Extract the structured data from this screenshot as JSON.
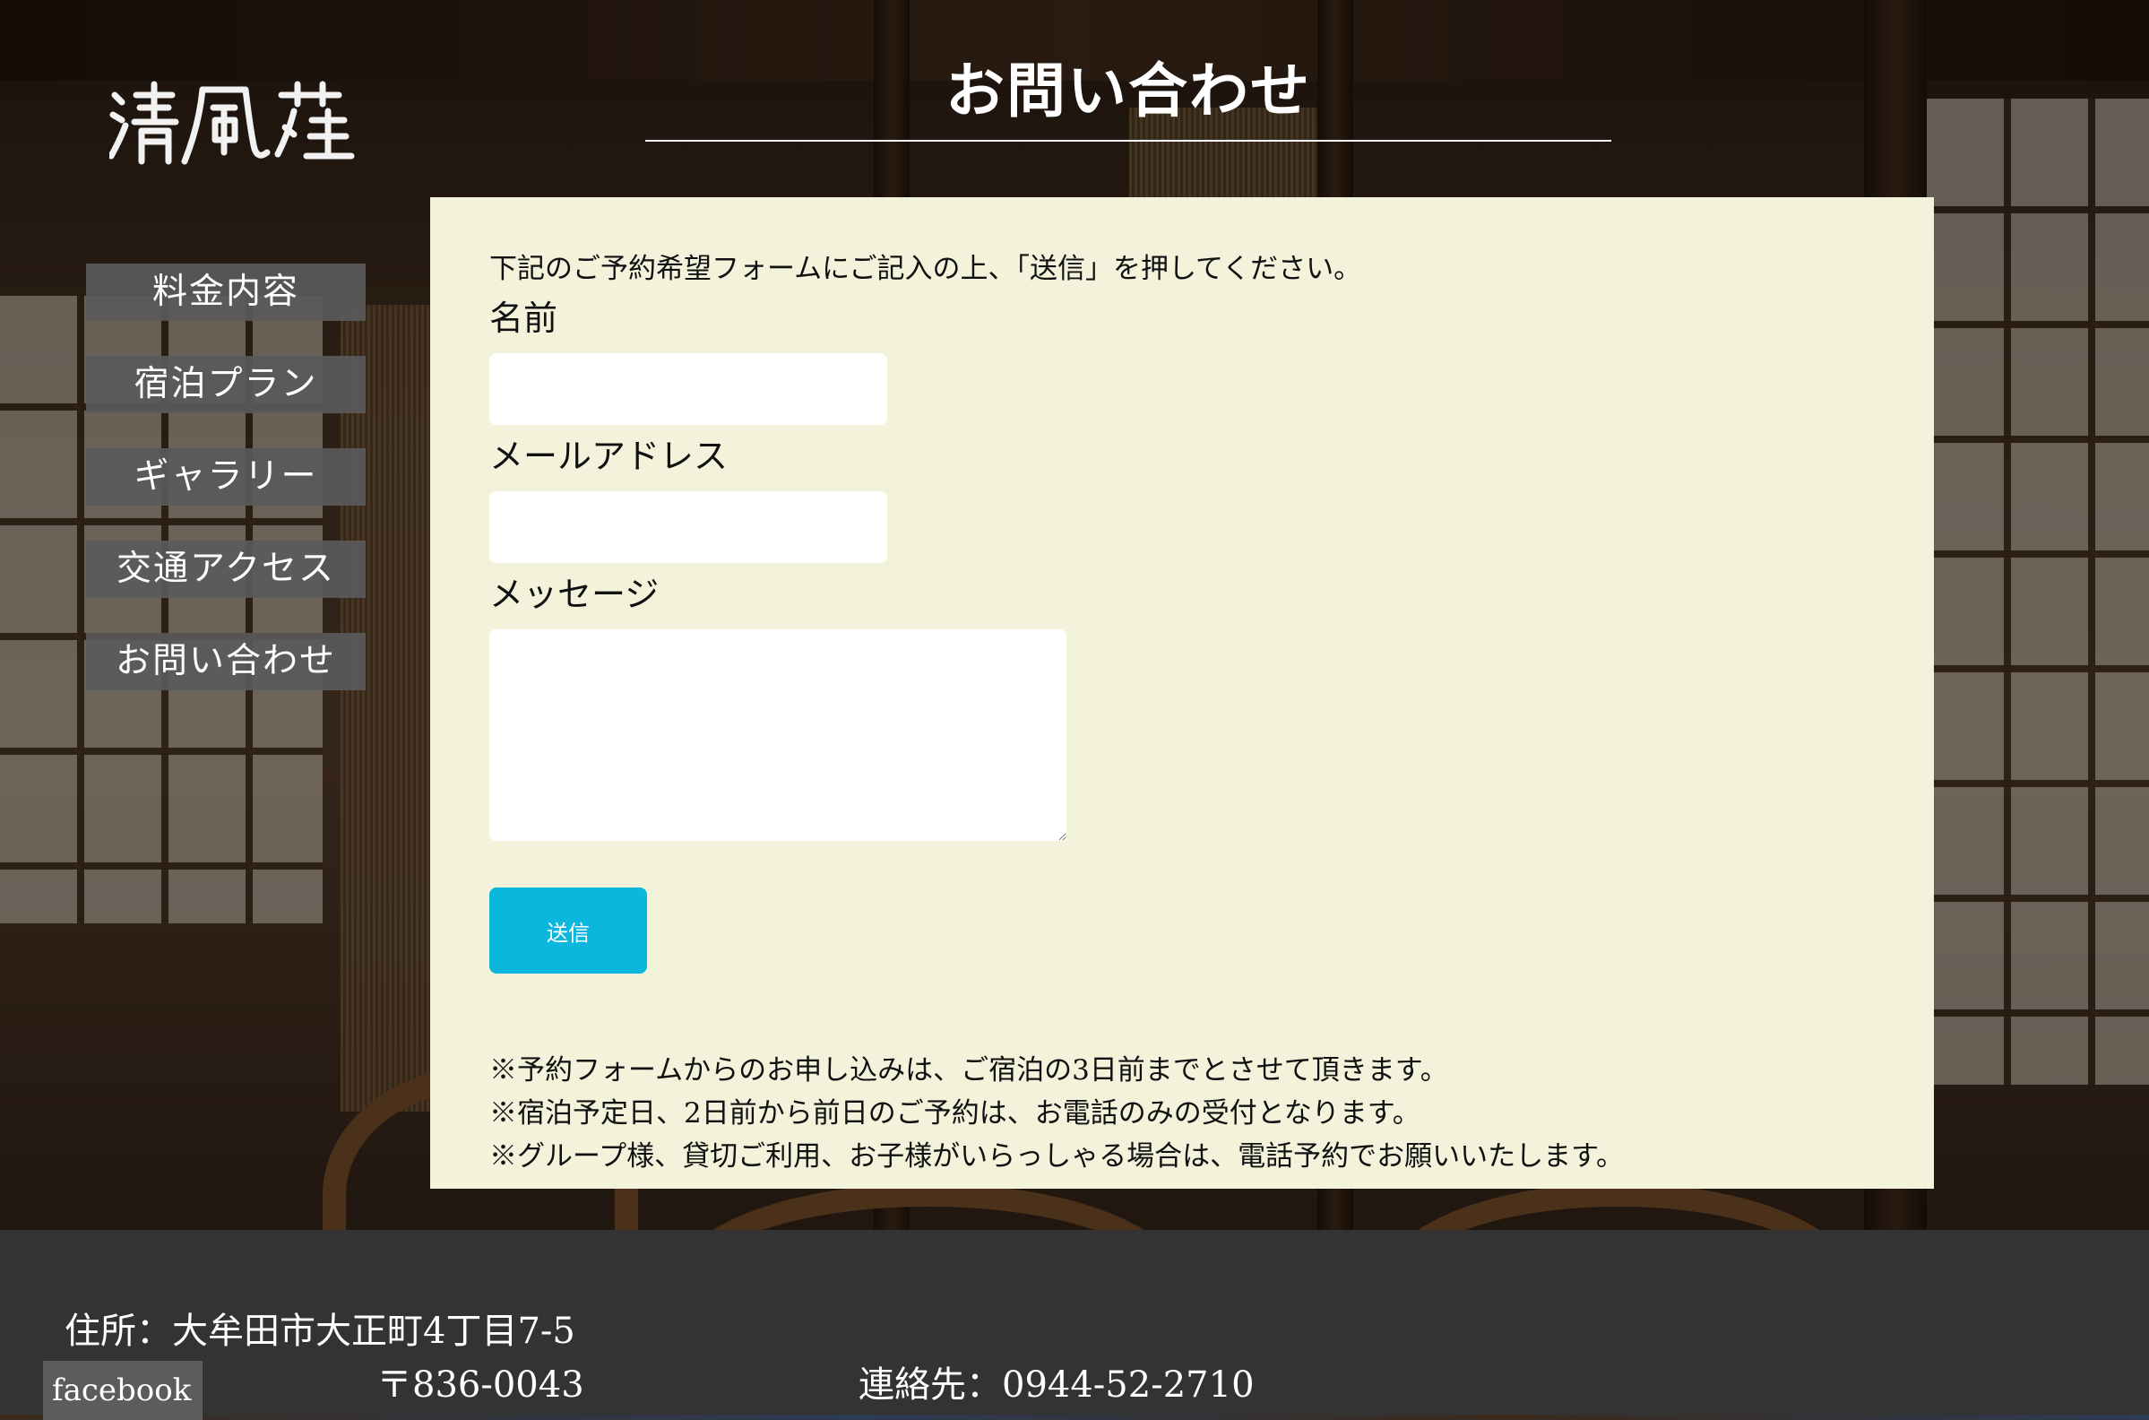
{
  "logo": {
    "text": "清風荘",
    "icon": "brush-calligraphy-logo"
  },
  "page_title": "お問い合わせ",
  "nav": {
    "items": [
      {
        "label": "料金内容"
      },
      {
        "label": "宿泊プラン"
      },
      {
        "label": "ギャラリー"
      },
      {
        "label": "交通アクセス"
      },
      {
        "label": "お問い合わせ"
      }
    ]
  },
  "form": {
    "intro": "下記のご予約希望フォームにご記入の上、「送信」を押してください。",
    "name_label": "名前",
    "name_value": "",
    "email_label": "メールアドレス",
    "email_value": "",
    "message_label": "メッセージ",
    "message_value": "",
    "submit_label": "送信"
  },
  "notes": [
    "※予約フォームからのお申し込みは、ご宿泊の3日前までとさせて頂きます。",
    "※宿泊予定日、2日前から前日のご予約は、お電話のみの受付となります。",
    "※グループ様、貸切ご利用、お子様がいらっしゃる場合は、電話予約でお願いいたします。"
  ],
  "footer": {
    "address": "住所：大牟田市大正町4丁目7-5",
    "postal": "〒836-0043",
    "contact": "連絡先：0944-52-2710",
    "facebook_label": "facebook"
  },
  "colors": {
    "panel_bg": "#f3f3dc",
    "submit_bg": "#0bb7dc",
    "nav_bg": "#5a5a5a",
    "footer_bg": "#333333"
  }
}
